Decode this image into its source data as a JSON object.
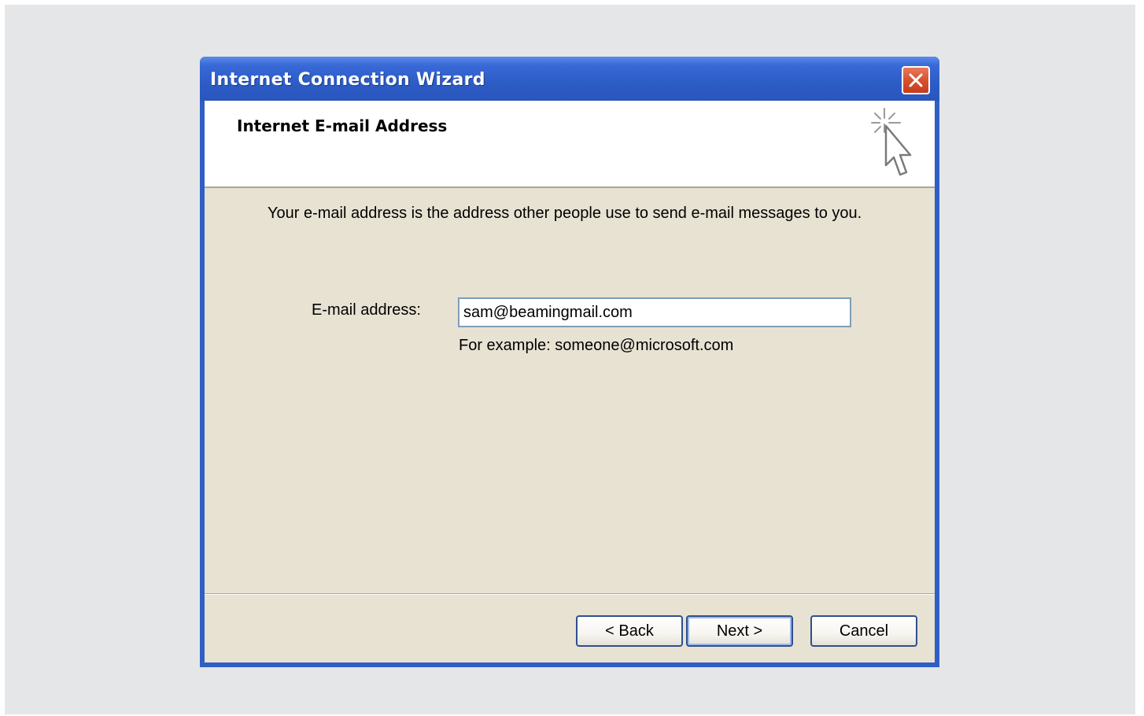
{
  "window": {
    "title": "Internet Connection Wizard",
    "close_icon": "close-x-icon"
  },
  "header": {
    "title": "Internet E-mail Address",
    "icon": "wizard-cursor-sparkle-icon"
  },
  "body": {
    "description": "Your e-mail address is the address other people use to send e-mail messages to you.",
    "email_label": "E-mail address:",
    "email_value": "sam@beamingmail.com",
    "example_text": "For example: someone@microsoft.com"
  },
  "buttons": {
    "back": "< Back",
    "next": "Next >",
    "cancel": "Cancel"
  },
  "colors": {
    "titlebar": "#2d5cc6",
    "client_background": "#e7e2d2",
    "close_button": "#d8502d"
  }
}
